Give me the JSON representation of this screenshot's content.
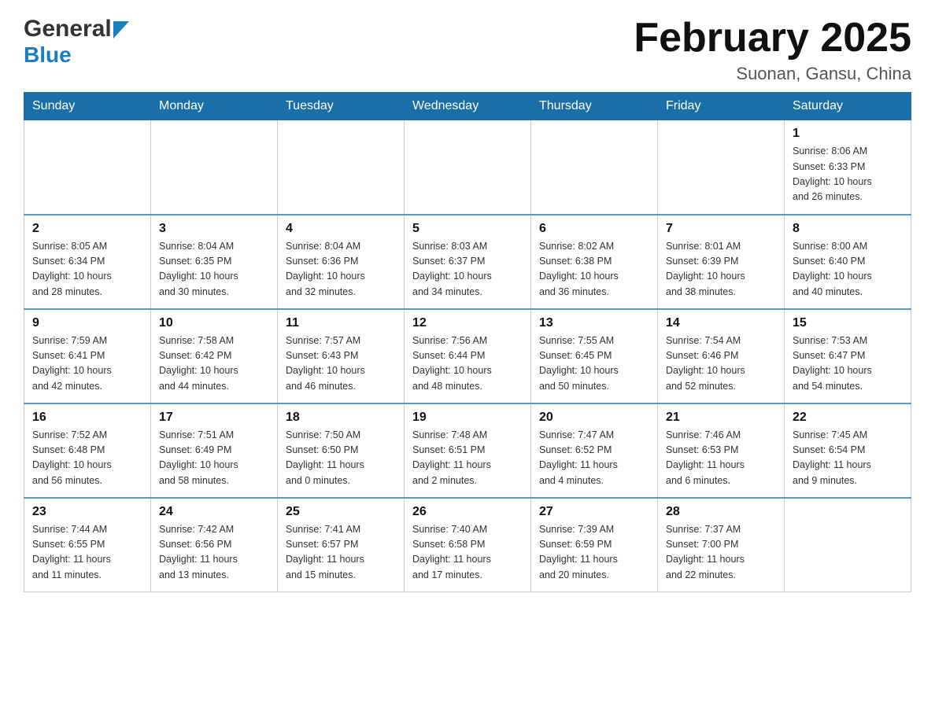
{
  "logo": {
    "general": "General",
    "blue": "Blue",
    "arrow_color": "#1a7fc1"
  },
  "title": {
    "month_year": "February 2025",
    "location": "Suonan, Gansu, China"
  },
  "weekdays": [
    "Sunday",
    "Monday",
    "Tuesday",
    "Wednesday",
    "Thursday",
    "Friday",
    "Saturday"
  ],
  "weeks": [
    [
      {
        "day": "",
        "info": ""
      },
      {
        "day": "",
        "info": ""
      },
      {
        "day": "",
        "info": ""
      },
      {
        "day": "",
        "info": ""
      },
      {
        "day": "",
        "info": ""
      },
      {
        "day": "",
        "info": ""
      },
      {
        "day": "1",
        "info": "Sunrise: 8:06 AM\nSunset: 6:33 PM\nDaylight: 10 hours\nand 26 minutes."
      }
    ],
    [
      {
        "day": "2",
        "info": "Sunrise: 8:05 AM\nSunset: 6:34 PM\nDaylight: 10 hours\nand 28 minutes."
      },
      {
        "day": "3",
        "info": "Sunrise: 8:04 AM\nSunset: 6:35 PM\nDaylight: 10 hours\nand 30 minutes."
      },
      {
        "day": "4",
        "info": "Sunrise: 8:04 AM\nSunset: 6:36 PM\nDaylight: 10 hours\nand 32 minutes."
      },
      {
        "day": "5",
        "info": "Sunrise: 8:03 AM\nSunset: 6:37 PM\nDaylight: 10 hours\nand 34 minutes."
      },
      {
        "day": "6",
        "info": "Sunrise: 8:02 AM\nSunset: 6:38 PM\nDaylight: 10 hours\nand 36 minutes."
      },
      {
        "day": "7",
        "info": "Sunrise: 8:01 AM\nSunset: 6:39 PM\nDaylight: 10 hours\nand 38 minutes."
      },
      {
        "day": "8",
        "info": "Sunrise: 8:00 AM\nSunset: 6:40 PM\nDaylight: 10 hours\nand 40 minutes."
      }
    ],
    [
      {
        "day": "9",
        "info": "Sunrise: 7:59 AM\nSunset: 6:41 PM\nDaylight: 10 hours\nand 42 minutes."
      },
      {
        "day": "10",
        "info": "Sunrise: 7:58 AM\nSunset: 6:42 PM\nDaylight: 10 hours\nand 44 minutes."
      },
      {
        "day": "11",
        "info": "Sunrise: 7:57 AM\nSunset: 6:43 PM\nDaylight: 10 hours\nand 46 minutes."
      },
      {
        "day": "12",
        "info": "Sunrise: 7:56 AM\nSunset: 6:44 PM\nDaylight: 10 hours\nand 48 minutes."
      },
      {
        "day": "13",
        "info": "Sunrise: 7:55 AM\nSunset: 6:45 PM\nDaylight: 10 hours\nand 50 minutes."
      },
      {
        "day": "14",
        "info": "Sunrise: 7:54 AM\nSunset: 6:46 PM\nDaylight: 10 hours\nand 52 minutes."
      },
      {
        "day": "15",
        "info": "Sunrise: 7:53 AM\nSunset: 6:47 PM\nDaylight: 10 hours\nand 54 minutes."
      }
    ],
    [
      {
        "day": "16",
        "info": "Sunrise: 7:52 AM\nSunset: 6:48 PM\nDaylight: 10 hours\nand 56 minutes."
      },
      {
        "day": "17",
        "info": "Sunrise: 7:51 AM\nSunset: 6:49 PM\nDaylight: 10 hours\nand 58 minutes."
      },
      {
        "day": "18",
        "info": "Sunrise: 7:50 AM\nSunset: 6:50 PM\nDaylight: 11 hours\nand 0 minutes."
      },
      {
        "day": "19",
        "info": "Sunrise: 7:48 AM\nSunset: 6:51 PM\nDaylight: 11 hours\nand 2 minutes."
      },
      {
        "day": "20",
        "info": "Sunrise: 7:47 AM\nSunset: 6:52 PM\nDaylight: 11 hours\nand 4 minutes."
      },
      {
        "day": "21",
        "info": "Sunrise: 7:46 AM\nSunset: 6:53 PM\nDaylight: 11 hours\nand 6 minutes."
      },
      {
        "day": "22",
        "info": "Sunrise: 7:45 AM\nSunset: 6:54 PM\nDaylight: 11 hours\nand 9 minutes."
      }
    ],
    [
      {
        "day": "23",
        "info": "Sunrise: 7:44 AM\nSunset: 6:55 PM\nDaylight: 11 hours\nand 11 minutes."
      },
      {
        "day": "24",
        "info": "Sunrise: 7:42 AM\nSunset: 6:56 PM\nDaylight: 11 hours\nand 13 minutes."
      },
      {
        "day": "25",
        "info": "Sunrise: 7:41 AM\nSunset: 6:57 PM\nDaylight: 11 hours\nand 15 minutes."
      },
      {
        "day": "26",
        "info": "Sunrise: 7:40 AM\nSunset: 6:58 PM\nDaylight: 11 hours\nand 17 minutes."
      },
      {
        "day": "27",
        "info": "Sunrise: 7:39 AM\nSunset: 6:59 PM\nDaylight: 11 hours\nand 20 minutes."
      },
      {
        "day": "28",
        "info": "Sunrise: 7:37 AM\nSunset: 7:00 PM\nDaylight: 11 hours\nand 22 minutes."
      },
      {
        "day": "",
        "info": ""
      }
    ]
  ]
}
